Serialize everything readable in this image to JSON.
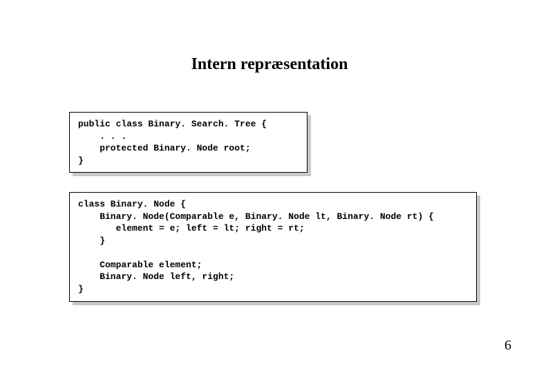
{
  "title": "Intern repræsentation",
  "code_box_1": "public class Binary. Search. Tree {\n    . . .\n    protected Binary. Node root;\n}",
  "code_box_2": "class Binary. Node {\n    Binary. Node(Comparable e, Binary. Node lt, Binary. Node rt) {\n       element = e; left = lt; right = rt;\n    }\n\n    Comparable element;\n    Binary. Node left, right;\n}",
  "page_number": "6"
}
